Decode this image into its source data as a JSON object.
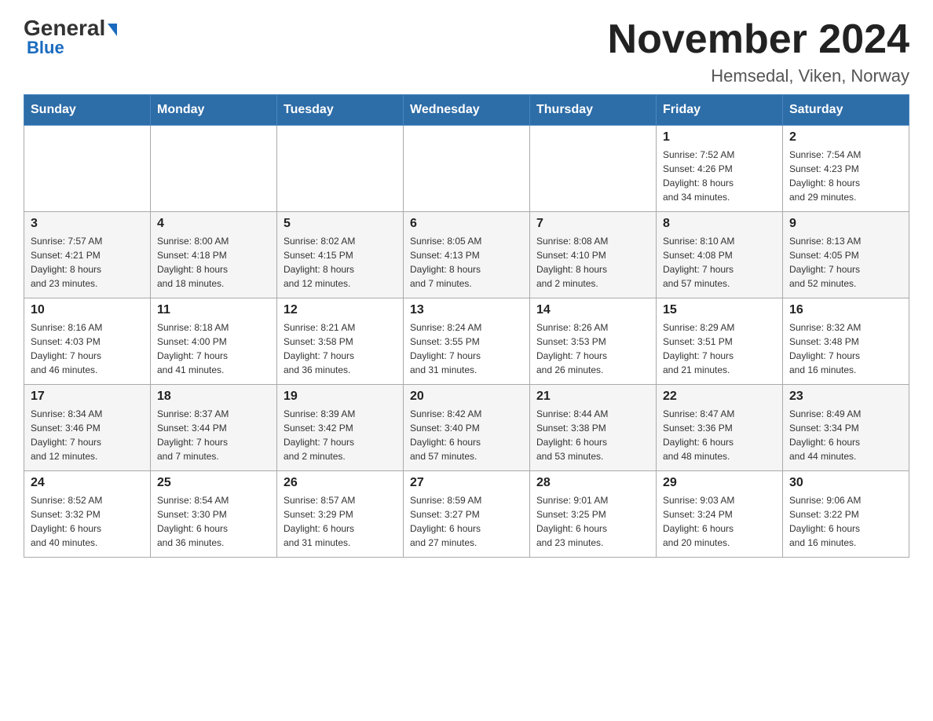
{
  "header": {
    "logo_main": "General",
    "logo_sub": "Blue",
    "title": "November 2024",
    "subtitle": "Hemsedal, Viken, Norway"
  },
  "weekdays": [
    "Sunday",
    "Monday",
    "Tuesday",
    "Wednesday",
    "Thursday",
    "Friday",
    "Saturday"
  ],
  "weeks": [
    [
      {
        "day": "",
        "info": ""
      },
      {
        "day": "",
        "info": ""
      },
      {
        "day": "",
        "info": ""
      },
      {
        "day": "",
        "info": ""
      },
      {
        "day": "",
        "info": ""
      },
      {
        "day": "1",
        "info": "Sunrise: 7:52 AM\nSunset: 4:26 PM\nDaylight: 8 hours\nand 34 minutes."
      },
      {
        "day": "2",
        "info": "Sunrise: 7:54 AM\nSunset: 4:23 PM\nDaylight: 8 hours\nand 29 minutes."
      }
    ],
    [
      {
        "day": "3",
        "info": "Sunrise: 7:57 AM\nSunset: 4:21 PM\nDaylight: 8 hours\nand 23 minutes."
      },
      {
        "day": "4",
        "info": "Sunrise: 8:00 AM\nSunset: 4:18 PM\nDaylight: 8 hours\nand 18 minutes."
      },
      {
        "day": "5",
        "info": "Sunrise: 8:02 AM\nSunset: 4:15 PM\nDaylight: 8 hours\nand 12 minutes."
      },
      {
        "day": "6",
        "info": "Sunrise: 8:05 AM\nSunset: 4:13 PM\nDaylight: 8 hours\nand 7 minutes."
      },
      {
        "day": "7",
        "info": "Sunrise: 8:08 AM\nSunset: 4:10 PM\nDaylight: 8 hours\nand 2 minutes."
      },
      {
        "day": "8",
        "info": "Sunrise: 8:10 AM\nSunset: 4:08 PM\nDaylight: 7 hours\nand 57 minutes."
      },
      {
        "day": "9",
        "info": "Sunrise: 8:13 AM\nSunset: 4:05 PM\nDaylight: 7 hours\nand 52 minutes."
      }
    ],
    [
      {
        "day": "10",
        "info": "Sunrise: 8:16 AM\nSunset: 4:03 PM\nDaylight: 7 hours\nand 46 minutes."
      },
      {
        "day": "11",
        "info": "Sunrise: 8:18 AM\nSunset: 4:00 PM\nDaylight: 7 hours\nand 41 minutes."
      },
      {
        "day": "12",
        "info": "Sunrise: 8:21 AM\nSunset: 3:58 PM\nDaylight: 7 hours\nand 36 minutes."
      },
      {
        "day": "13",
        "info": "Sunrise: 8:24 AM\nSunset: 3:55 PM\nDaylight: 7 hours\nand 31 minutes."
      },
      {
        "day": "14",
        "info": "Sunrise: 8:26 AM\nSunset: 3:53 PM\nDaylight: 7 hours\nand 26 minutes."
      },
      {
        "day": "15",
        "info": "Sunrise: 8:29 AM\nSunset: 3:51 PM\nDaylight: 7 hours\nand 21 minutes."
      },
      {
        "day": "16",
        "info": "Sunrise: 8:32 AM\nSunset: 3:48 PM\nDaylight: 7 hours\nand 16 minutes."
      }
    ],
    [
      {
        "day": "17",
        "info": "Sunrise: 8:34 AM\nSunset: 3:46 PM\nDaylight: 7 hours\nand 12 minutes."
      },
      {
        "day": "18",
        "info": "Sunrise: 8:37 AM\nSunset: 3:44 PM\nDaylight: 7 hours\nand 7 minutes."
      },
      {
        "day": "19",
        "info": "Sunrise: 8:39 AM\nSunset: 3:42 PM\nDaylight: 7 hours\nand 2 minutes."
      },
      {
        "day": "20",
        "info": "Sunrise: 8:42 AM\nSunset: 3:40 PM\nDaylight: 6 hours\nand 57 minutes."
      },
      {
        "day": "21",
        "info": "Sunrise: 8:44 AM\nSunset: 3:38 PM\nDaylight: 6 hours\nand 53 minutes."
      },
      {
        "day": "22",
        "info": "Sunrise: 8:47 AM\nSunset: 3:36 PM\nDaylight: 6 hours\nand 48 minutes."
      },
      {
        "day": "23",
        "info": "Sunrise: 8:49 AM\nSunset: 3:34 PM\nDaylight: 6 hours\nand 44 minutes."
      }
    ],
    [
      {
        "day": "24",
        "info": "Sunrise: 8:52 AM\nSunset: 3:32 PM\nDaylight: 6 hours\nand 40 minutes."
      },
      {
        "day": "25",
        "info": "Sunrise: 8:54 AM\nSunset: 3:30 PM\nDaylight: 6 hours\nand 36 minutes."
      },
      {
        "day": "26",
        "info": "Sunrise: 8:57 AM\nSunset: 3:29 PM\nDaylight: 6 hours\nand 31 minutes."
      },
      {
        "day": "27",
        "info": "Sunrise: 8:59 AM\nSunset: 3:27 PM\nDaylight: 6 hours\nand 27 minutes."
      },
      {
        "day": "28",
        "info": "Sunrise: 9:01 AM\nSunset: 3:25 PM\nDaylight: 6 hours\nand 23 minutes."
      },
      {
        "day": "29",
        "info": "Sunrise: 9:03 AM\nSunset: 3:24 PM\nDaylight: 6 hours\nand 20 minutes."
      },
      {
        "day": "30",
        "info": "Sunrise: 9:06 AM\nSunset: 3:22 PM\nDaylight: 6 hours\nand 16 minutes."
      }
    ]
  ]
}
